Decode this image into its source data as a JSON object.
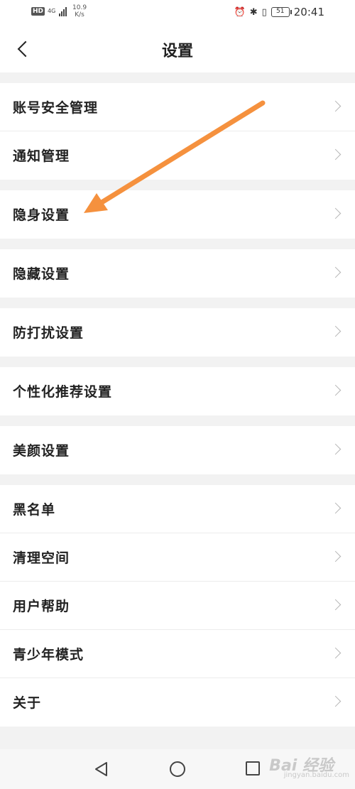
{
  "status_bar": {
    "hd": "HD",
    "network": "4G",
    "speed_value": "10.9",
    "speed_unit": "K/s",
    "battery": "51",
    "time": "20:41",
    "icons": [
      "alarm-icon",
      "bluetooth-icon",
      "vibrate-icon"
    ]
  },
  "header": {
    "title": "设置",
    "back_icon": "chevron-left-icon"
  },
  "settings": {
    "items": [
      {
        "label": "账号安全管理"
      },
      {
        "label": "通知管理"
      },
      {
        "label": "隐身设置"
      },
      {
        "label": "隐藏设置"
      },
      {
        "label": "防打扰设置"
      },
      {
        "label": "个性化推荐设置"
      },
      {
        "label": "美颜设置"
      },
      {
        "label": "黑名单"
      },
      {
        "label": "清理空间"
      },
      {
        "label": "用户帮助"
      },
      {
        "label": "青少年模式"
      },
      {
        "label": "关于"
      }
    ]
  },
  "annotation": {
    "color": "#f5913e",
    "points_to": "隐身设置"
  },
  "nav_bar": {
    "icons": [
      "triangle-back-icon",
      "circle-home-icon",
      "square-recent-icon"
    ]
  },
  "watermark": {
    "text": "Bai 经验",
    "sub": "jingyan.baidu.com"
  }
}
